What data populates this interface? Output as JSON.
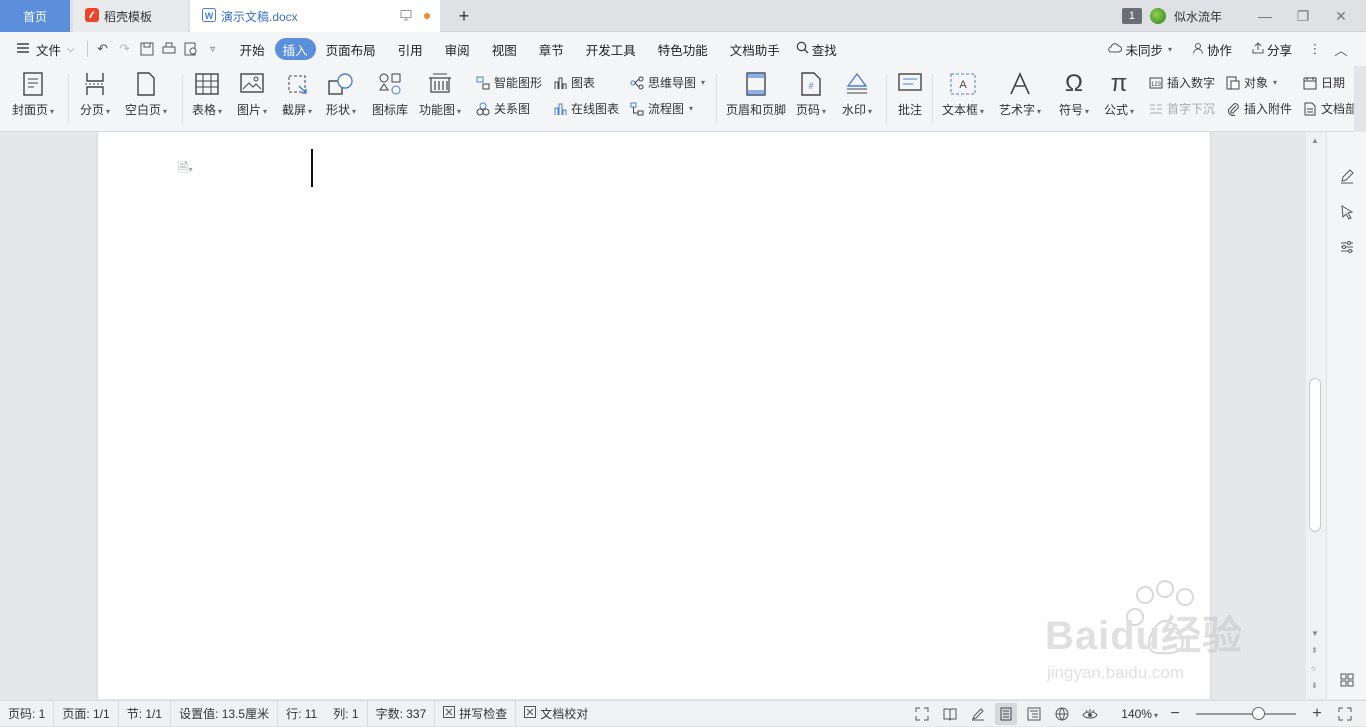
{
  "tabs": {
    "home": "首页",
    "template": "稻壳模板",
    "document": "演示文稿.docx"
  },
  "window": {
    "count_badge": "1",
    "username": "似水流年"
  },
  "menu": {
    "file": "文件",
    "items": [
      "开始",
      "插入",
      "页面布局",
      "引用",
      "审阅",
      "视图",
      "章节",
      "开发工具",
      "特色功能",
      "文档助手"
    ],
    "active": "插入",
    "search": "查找",
    "sync": "未同步",
    "collab": "协作",
    "share": "分享"
  },
  "ribbon": {
    "cover_page": "封面页",
    "page_break": "分页",
    "blank_page": "空白页",
    "table": "表格",
    "picture": "图片",
    "screenshot": "截屏",
    "shape": "形状",
    "icon_library": "图标库",
    "function_chart": "功能图",
    "smart_art": "智能图形",
    "relation_chart": "关系图",
    "chart": "图表",
    "online_chart": "在线图表",
    "mind_map": "思维导图",
    "flow_chart": "流程图",
    "header_footer": "页眉和页脚",
    "page_number": "页码",
    "watermark": "水印",
    "comment": "批注",
    "text_box": "文本框",
    "word_art": "艺术字",
    "symbol": "符号",
    "formula": "公式",
    "insert_number": "插入数字",
    "drop_cap": "首字下沉",
    "object": "对象",
    "attachment": "插入附件",
    "date": "日期",
    "doc_part": "文档部"
  },
  "status": {
    "page_code": "页码: 1",
    "page": "页面: 1/1",
    "section": "节: 1/1",
    "position": "设置值: 13.5厘米",
    "row": "行: 11",
    "col": "列: 1",
    "word_count": "字数: 337",
    "spell_check": "拼写检查",
    "doc_proof": "文档校对",
    "zoom": "140%"
  },
  "watermark": {
    "brand": "Baidu经验",
    "url": "jingyan.baidu.com"
  },
  "colors": {
    "accent": "#5b8fdc",
    "modified_dot": "#f08a2a"
  }
}
